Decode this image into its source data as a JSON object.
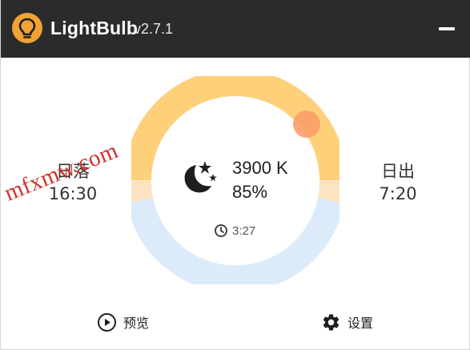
{
  "titlebar": {
    "app_name": "LightBulb",
    "version": "v2.7.1",
    "icon": "lightbulb-icon",
    "minimize_icon": "minimize-icon"
  },
  "sunset": {
    "label": "日落",
    "time": "16:30"
  },
  "sunrise": {
    "label": "日出",
    "time": "7:20"
  },
  "status": {
    "temperature": "3900 K",
    "brightness": "85%",
    "mode_icon": "moon-stars-icon",
    "timer_icon": "clock-icon",
    "time_until_next": "3:27"
  },
  "cycle": {
    "current_position_fraction": 0.14,
    "colors": {
      "day_arc": "#ffd07a",
      "night_arc": "#dcebfa",
      "transition": "#fde4c0",
      "indicator": "#f99f6a"
    }
  },
  "watermark": {
    "text": "mfxmw.com"
  },
  "footer": {
    "preview_label": "预览",
    "preview_icon": "play-circle-icon",
    "settings_label": "设置",
    "settings_icon": "gear-icon"
  },
  "colors": {
    "titlebar_bg": "#2b2b2b",
    "app_icon_bg": "#f1a234",
    "watermark": "#d0312a"
  }
}
